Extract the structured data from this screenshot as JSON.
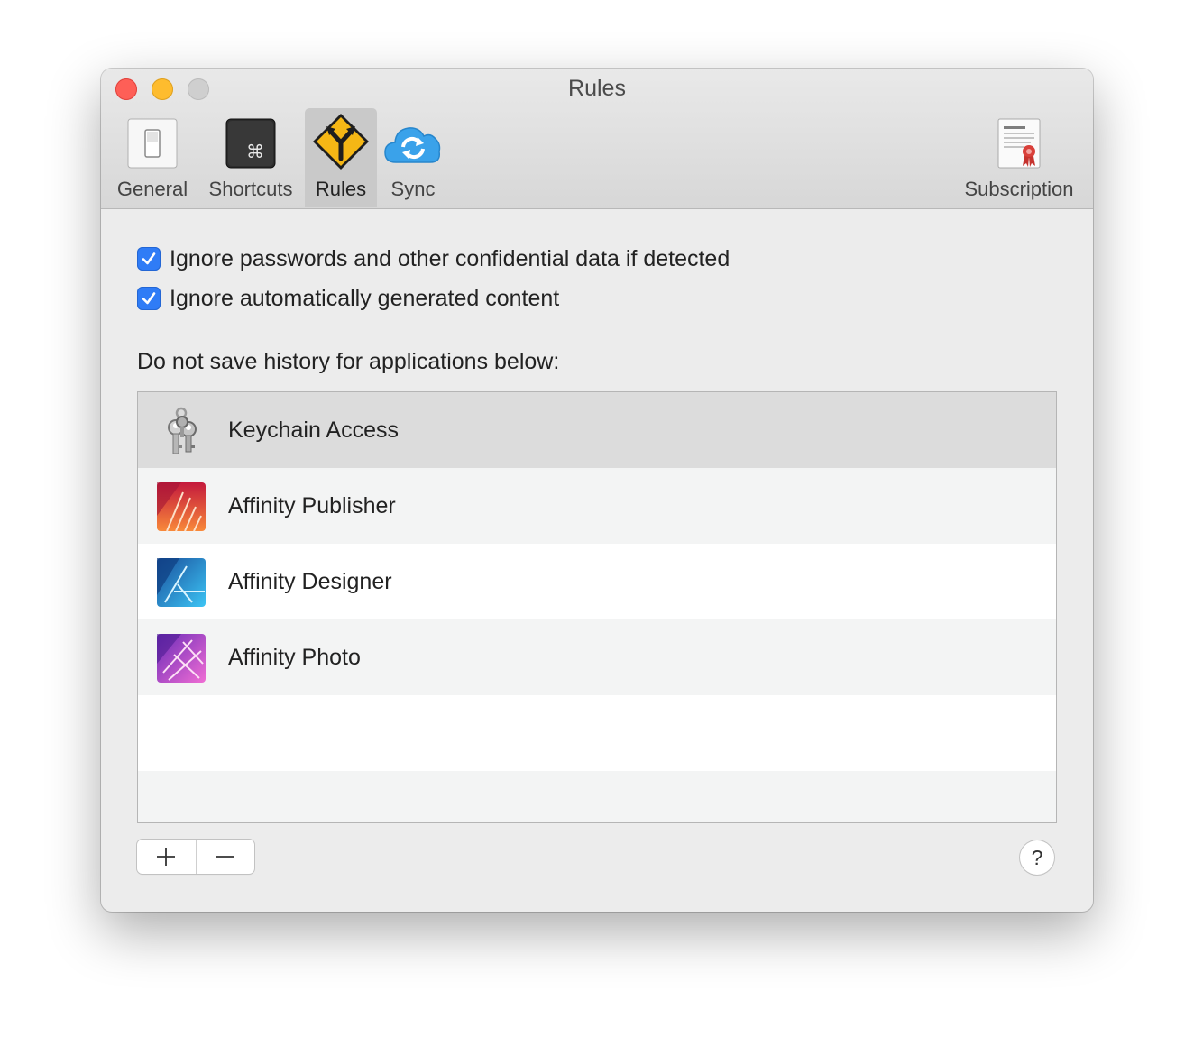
{
  "window": {
    "title": "Rules"
  },
  "toolbar": {
    "tabs": [
      {
        "label": "General",
        "icon": "switch-icon"
      },
      {
        "label": "Shortcuts",
        "icon": "command-key-icon"
      },
      {
        "label": "Rules",
        "icon": "road-sign-icon",
        "active": true
      },
      {
        "label": "Sync",
        "icon": "cloud-sync-icon"
      },
      {
        "label": "Subscription",
        "icon": "certificate-icon"
      }
    ],
    "command_glyph": "⌘"
  },
  "rules": {
    "ignore_passwords": {
      "label": "Ignore passwords and other confidential data if detected",
      "checked": true
    },
    "ignore_generated": {
      "label": "Ignore automatically generated content",
      "checked": true
    },
    "section_label": "Do not save history for applications below:"
  },
  "apps": [
    {
      "name": "Keychain Access",
      "icon": "keychain-icon",
      "selected": true
    },
    {
      "name": "Affinity Publisher",
      "icon": "affinity-publisher-icon"
    },
    {
      "name": "Affinity Designer",
      "icon": "affinity-designer-icon"
    },
    {
      "name": "Affinity Photo",
      "icon": "affinity-photo-icon"
    }
  ],
  "buttons": {
    "help": "?"
  },
  "colors": {
    "accent": "#2f7cf6",
    "close": "#fe5f57",
    "minimize": "#febc2e",
    "zoom_inactive": "#cfcfcf",
    "selected_row": "#dcdcdc",
    "alt_row": "#f3f4f4"
  }
}
